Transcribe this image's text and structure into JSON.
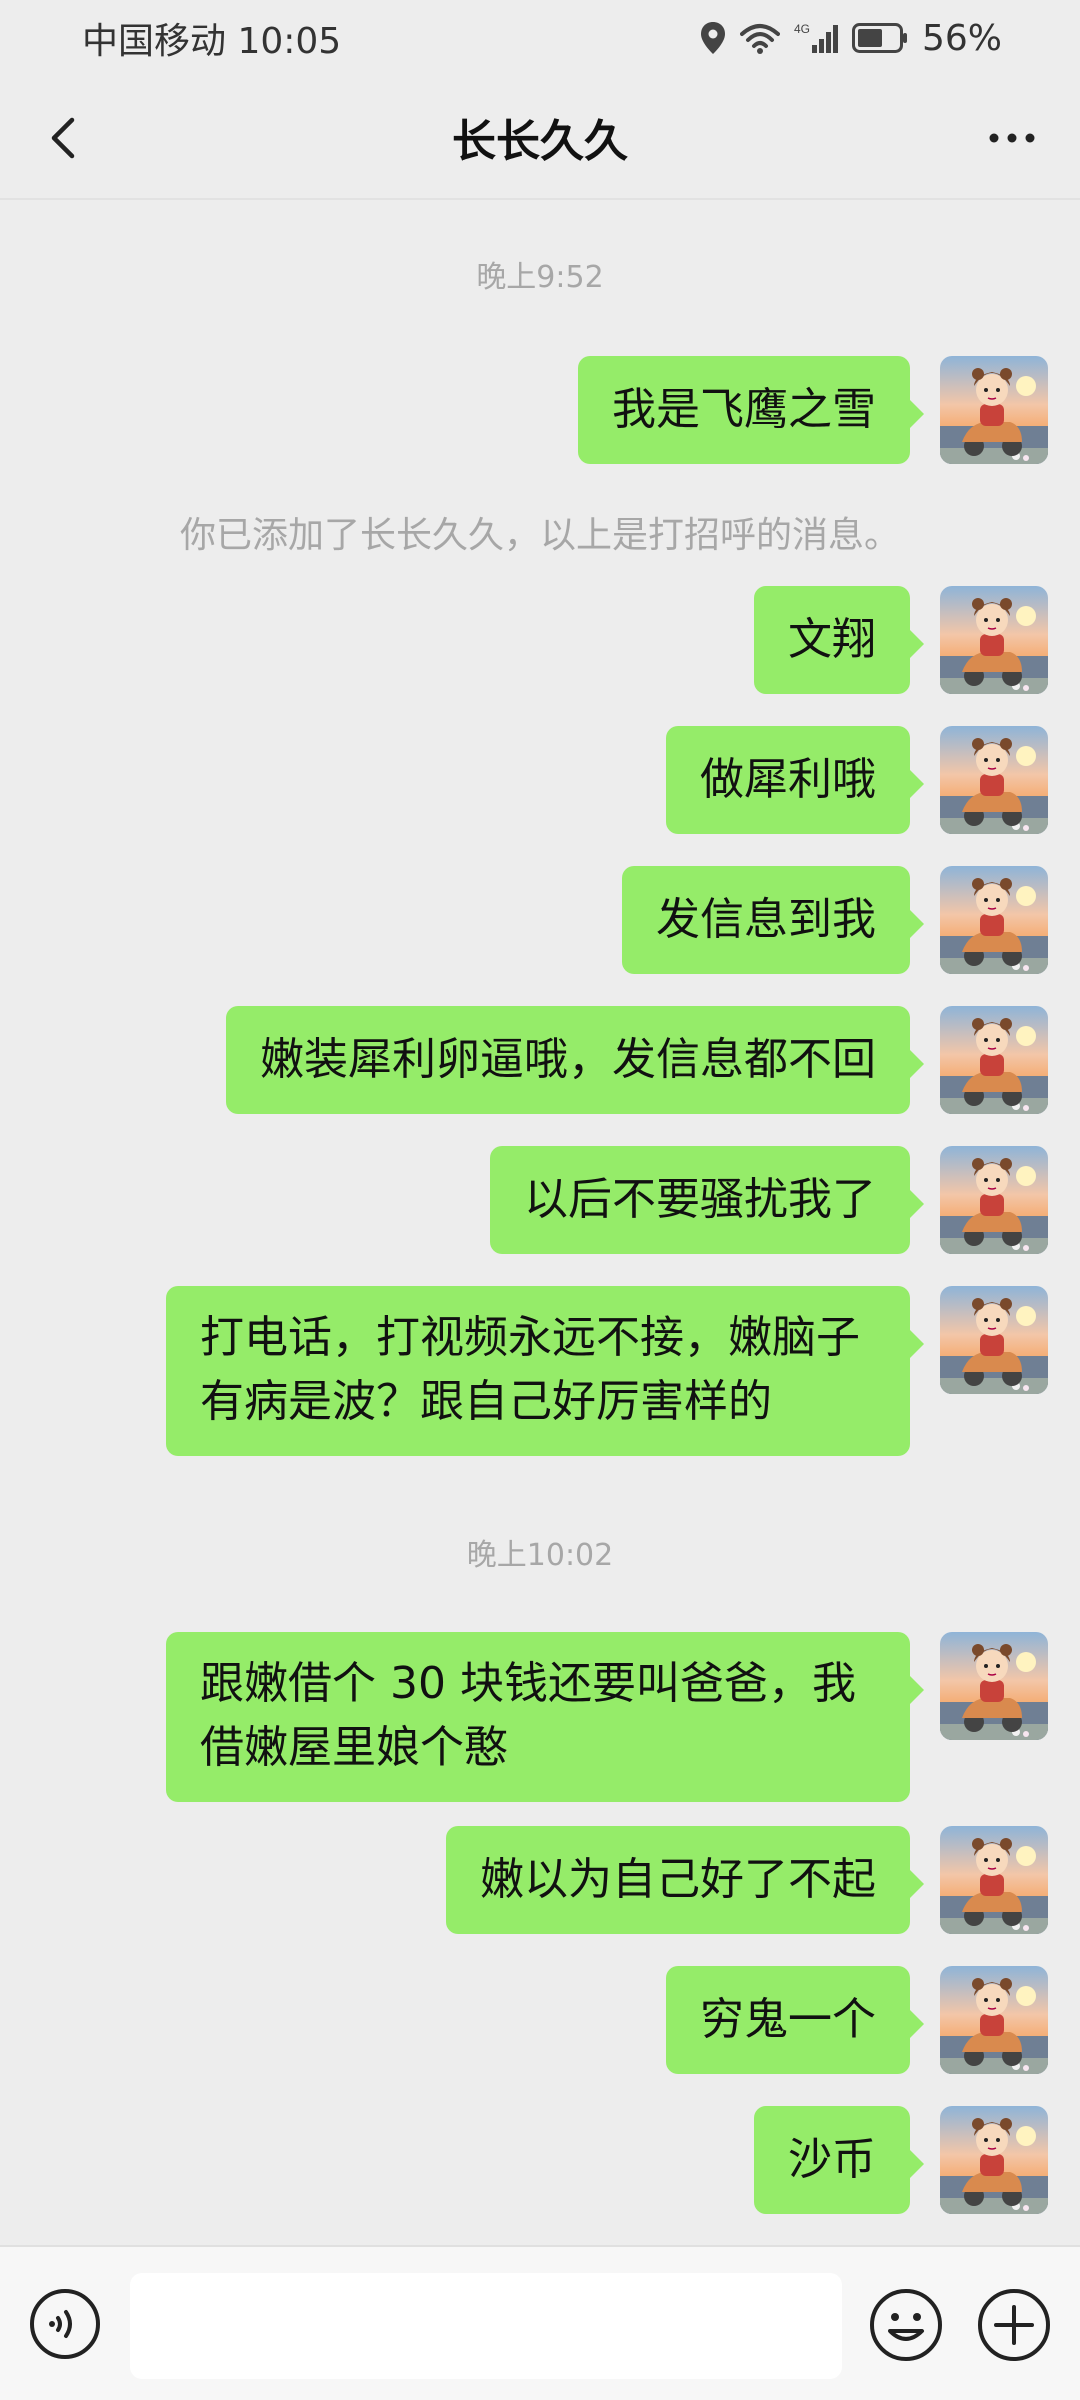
{
  "status_bar": {
    "carrier_time": "中国移动 10:05",
    "network": "4G",
    "battery": "56%"
  },
  "header": {
    "title": "长长久久"
  },
  "chat": {
    "time1": "晚上9:52",
    "system_notice": "你已添加了长长久久，以上是打招呼的消息。",
    "time2": "晚上10:02",
    "messages": [
      "我是飞鹰之雪",
      "文翔",
      "做犀利哦",
      "发信息到我",
      "嫩装犀利卵逼哦，发信息都不回",
      "以后不要骚扰我了",
      "打电话，打视频永远不接，嫩脑子有病是波？跟自己好厉害样的",
      "跟嫩借个 30 块钱还要叫爸爸，我借嫩屋里娘个憨",
      "嫩以为自己好了不起",
      "穷鬼一个",
      "沙币"
    ]
  },
  "bottom_bar": {
    "input_value": ""
  },
  "colors": {
    "bubble": "#95ec69",
    "background": "#ededed"
  },
  "icons": [
    "location-icon",
    "wifi-icon",
    "signal-icon",
    "battery-icon",
    "back-arrow-icon",
    "more-icon",
    "voice-icon",
    "mic-icon",
    "emoji-icon",
    "plus-icon"
  ]
}
